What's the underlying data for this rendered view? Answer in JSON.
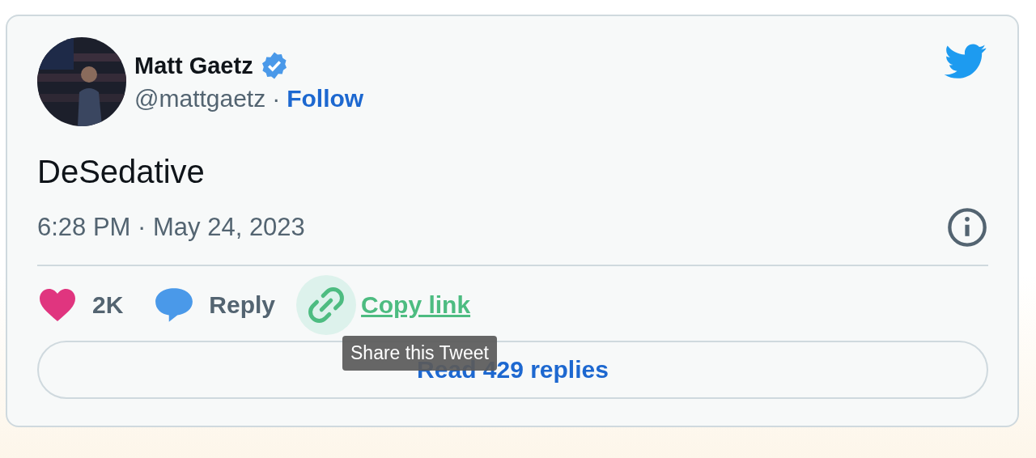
{
  "author": {
    "name": "Matt Gaetz",
    "verified": true,
    "handle": "@mattgaetz",
    "separator": "·",
    "follow": "Follow"
  },
  "text": "DeSedative",
  "timestamp": "6:28 PM · May 24, 2023",
  "actions": [
    {
      "kind": "like",
      "label": "2K",
      "hovered": false
    },
    {
      "kind": "reply",
      "label": "Reply",
      "hovered": false
    },
    {
      "kind": "copy",
      "label": "Copy link",
      "hovered": true
    }
  ],
  "tooltip": "Share this Tweet",
  "replies_button": "Read 429 replies"
}
